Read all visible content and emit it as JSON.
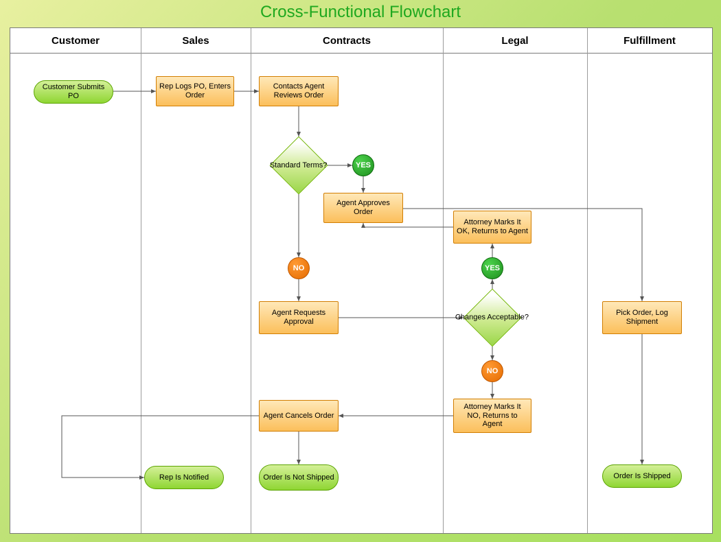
{
  "title": "Cross-Functional Flowchart",
  "lanes": {
    "customer": "Customer",
    "sales": "Sales",
    "contracts": "Contracts",
    "legal": "Legal",
    "fulfillment": "Fulfillment"
  },
  "nodes": {
    "start": "Customer Submits PO",
    "rep_logs": "Rep Logs PO, Enters Order",
    "agent_reviews": "Contacts Agent Reviews Order",
    "std_terms": "Standard Terms?",
    "agent_approves": "Agent Approves Order",
    "agent_requests": "Agent Requests Approval",
    "agent_cancels": "Agent Cancels Order",
    "atty_ok": "Attorney Marks It OK, Returns to Agent",
    "atty_no": "Attorney Marks It NO, Returns to Agent",
    "changes_ok": "Changes Acceptable?",
    "pick_order": "Pick Order, Log Shipment",
    "rep_notified": "Rep Is Notified",
    "not_shipped": "Order Is Not Shipped",
    "shipped": "Order Is Shipped"
  },
  "labels": {
    "yes": "YES",
    "no": "NO"
  }
}
